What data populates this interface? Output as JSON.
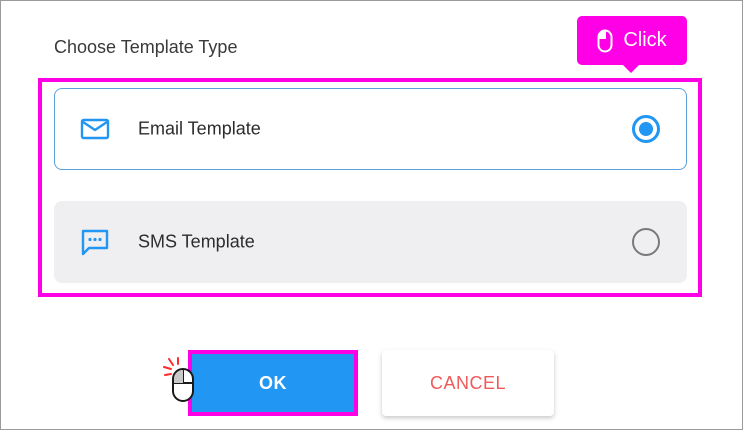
{
  "dialog": {
    "title": "Choose Template Type"
  },
  "options": [
    {
      "label": "Email Template",
      "icon": "envelope-icon",
      "selected": true
    },
    {
      "label": "SMS Template",
      "icon": "sms-message-icon",
      "selected": false
    }
  ],
  "tooltip": {
    "label": "Click",
    "icon": "mouse-icon"
  },
  "buttons": {
    "ok_label": "OK",
    "cancel_label": "CANCEL"
  },
  "colors": {
    "accent": "#2196f3",
    "highlight": "#ff00e6",
    "cancel_text": "#f05a5a",
    "unselected_bg": "#efeff1"
  }
}
